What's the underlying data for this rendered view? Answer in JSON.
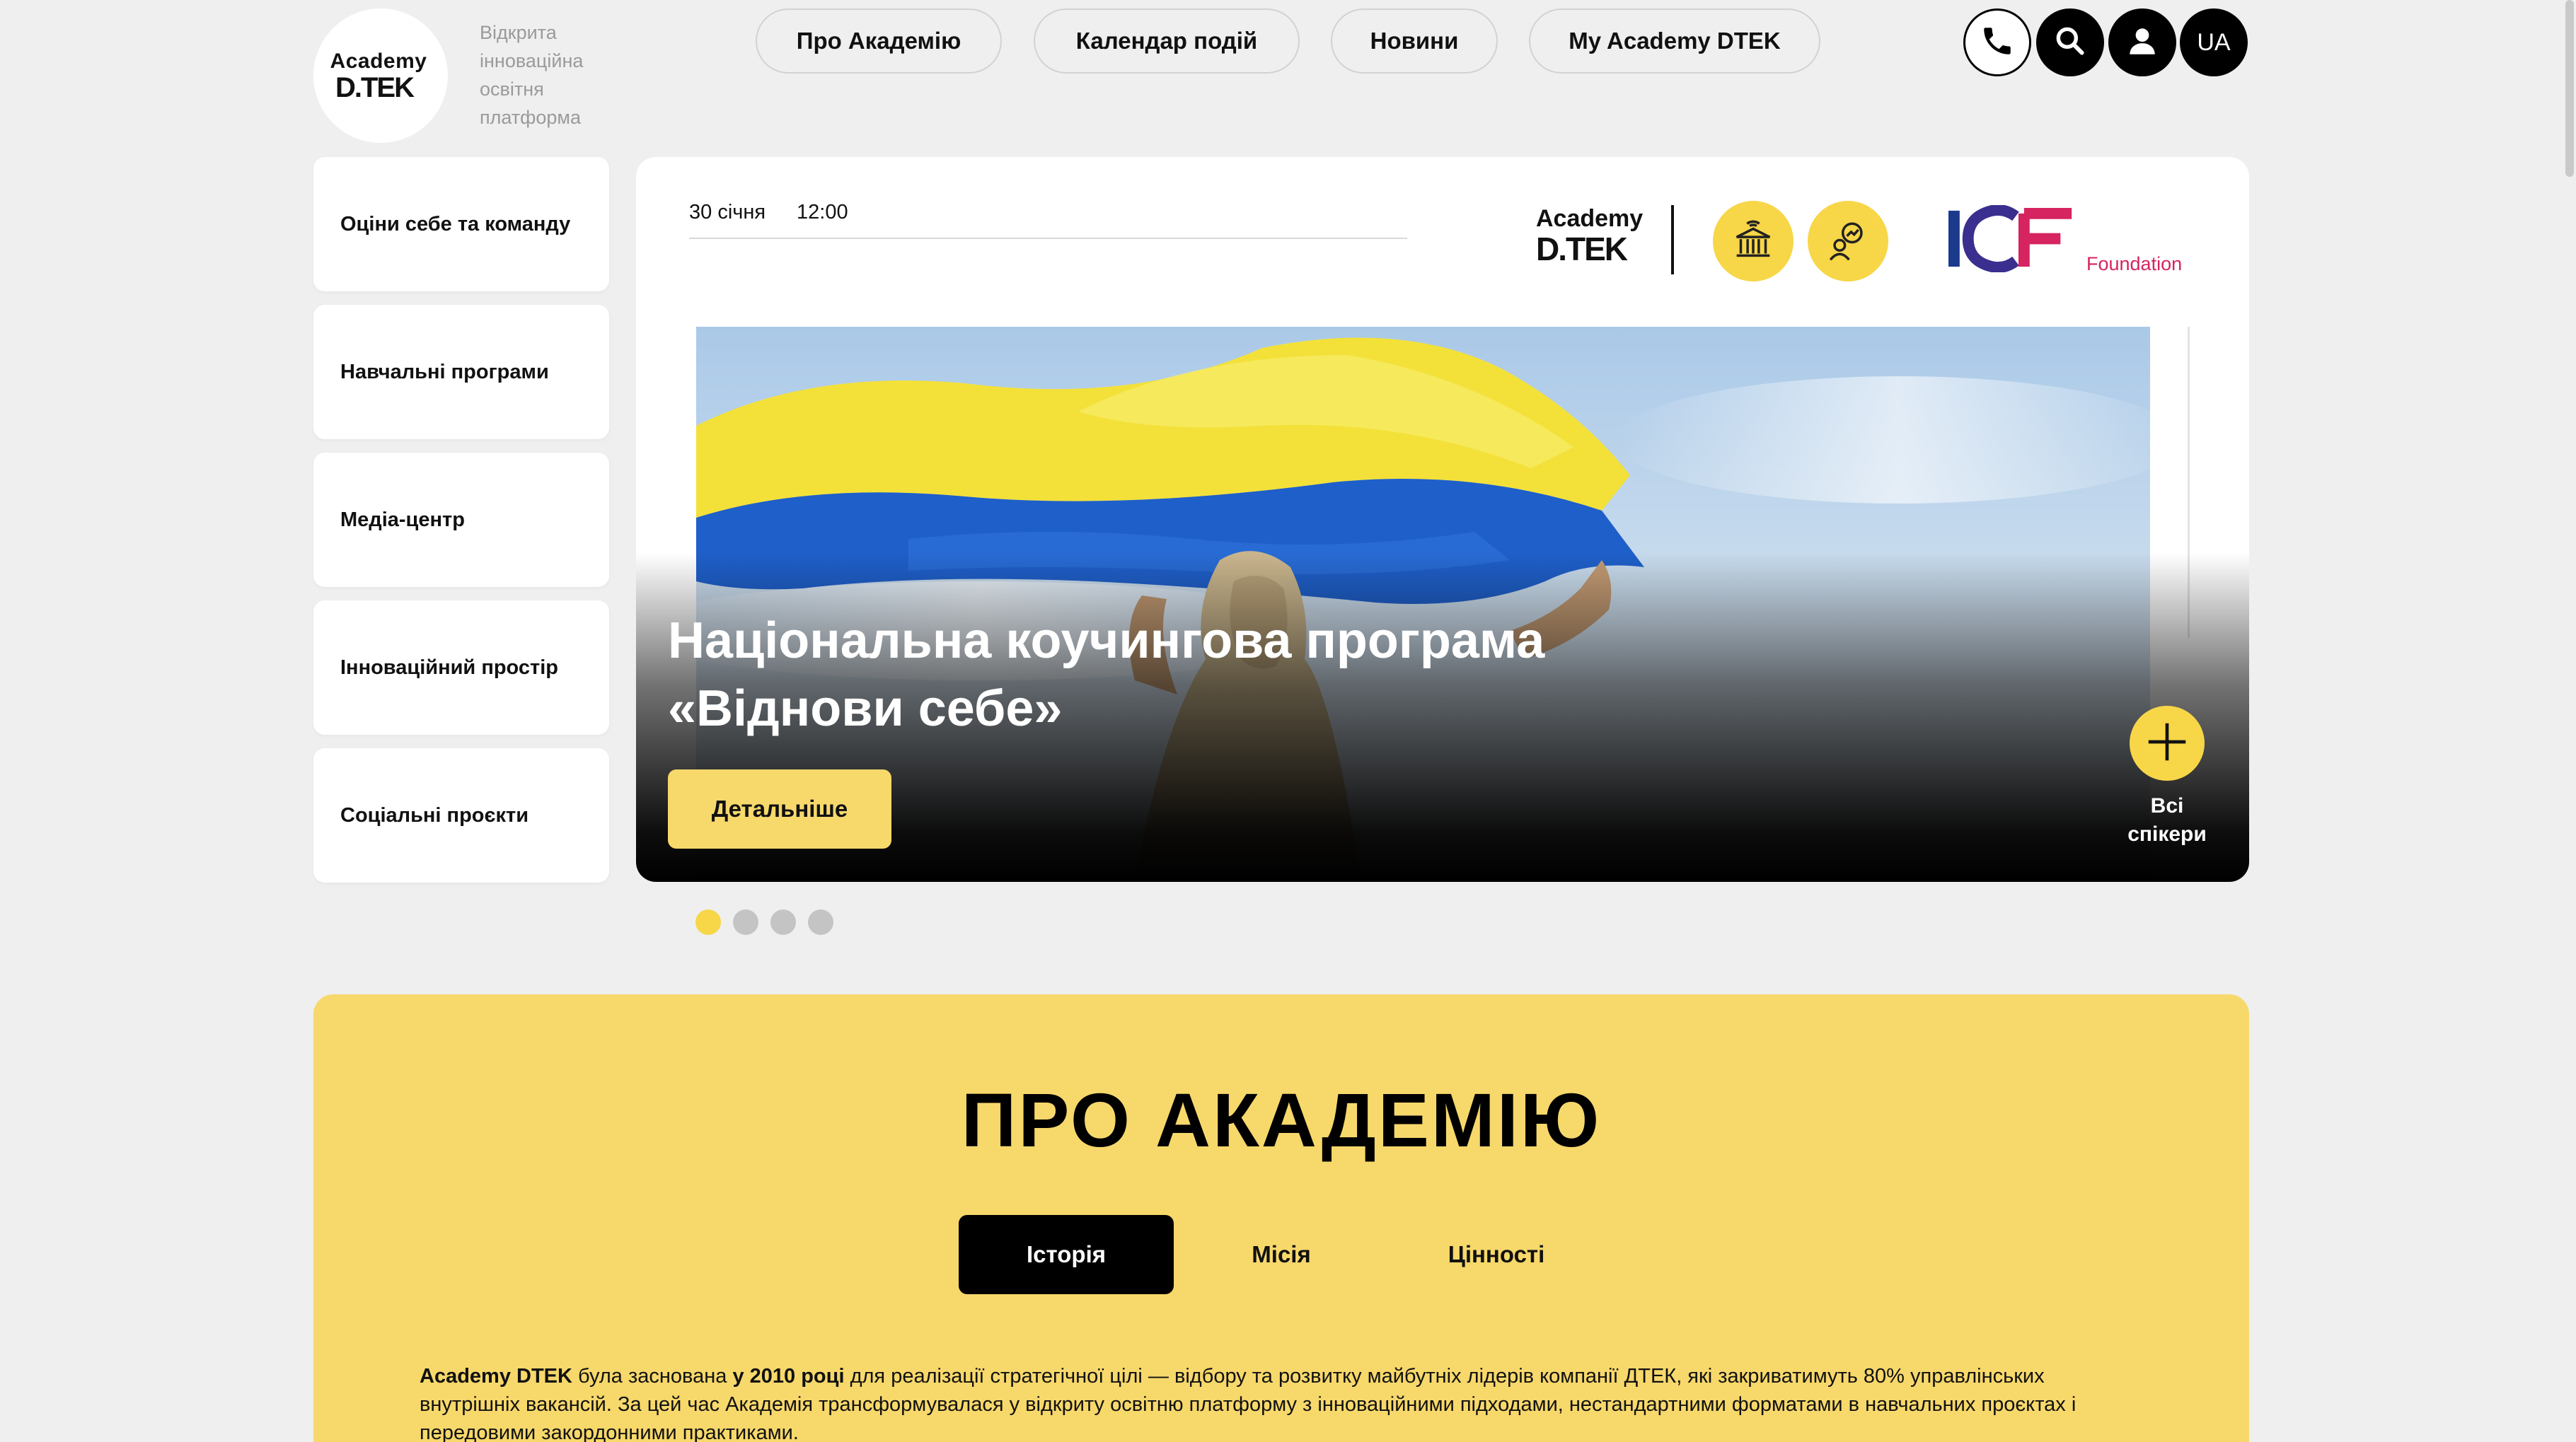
{
  "header": {
    "logo_academy": "Academy",
    "logo_dtek": "D.TEK",
    "tagline": "Відкрита інноваційна освітня платформа",
    "nav": [
      {
        "label": "Про Академію"
      },
      {
        "label": "Календар подій"
      },
      {
        "label": "Новини"
      },
      {
        "label": "My Academy DTEK"
      }
    ],
    "icons": [
      "phone-icon",
      "search-icon",
      "user-icon"
    ],
    "language": "UA"
  },
  "sidebar": {
    "items": [
      {
        "label": "Оціни себе та команду"
      },
      {
        "label": "Навчальні програми"
      },
      {
        "label": "Медіа-центр"
      },
      {
        "label": "Інноваційний простір"
      },
      {
        "label": "Соціальні проєкти"
      }
    ]
  },
  "hero": {
    "date": "30 січня",
    "time": "12:00",
    "partner_academy": "Academy",
    "partner_dtek": "D.TEK",
    "partner_icf": "ICF",
    "partner_icf_sub": "Foundation",
    "title_line1": "Національна коучингова програма",
    "title_line2": "«Віднови себе»",
    "details_button": "Детальніше",
    "all_speakers_line1": "Всі",
    "all_speakers_line2": "спікери",
    "flag_colors": {
      "blue": "#1f5fc9",
      "yellow": "#f3e13a"
    }
  },
  "slider": {
    "slides_count": 4,
    "active_index": 0
  },
  "about": {
    "title": "ПРО АКАДЕМІЮ",
    "tabs": [
      {
        "label": "Історія"
      },
      {
        "label": "Місія"
      },
      {
        "label": "Цінності"
      }
    ],
    "active_tab": "Історія",
    "text_part1": "Academy DTEK",
    "text_part2": " була заснована ",
    "text_part3": "у 2010 році",
    "text_part4": " для реалізації стратегічної цілі — відбору та розвитку майбутніх лідерів компанії ДТЕК, які закриватимуть 80% управлінських внутрішніх вакансій. За цей час Академія трансформувалася у відкриту освітню платформу з інноваційними підходами, нестандартними форматами в навчальних проєктах і передовими закордонними практиками."
  },
  "colors": {
    "accent_yellow": "#f7d86b",
    "dark": "#000000",
    "background": "#efefef",
    "icf_pink": "#d5245f"
  }
}
